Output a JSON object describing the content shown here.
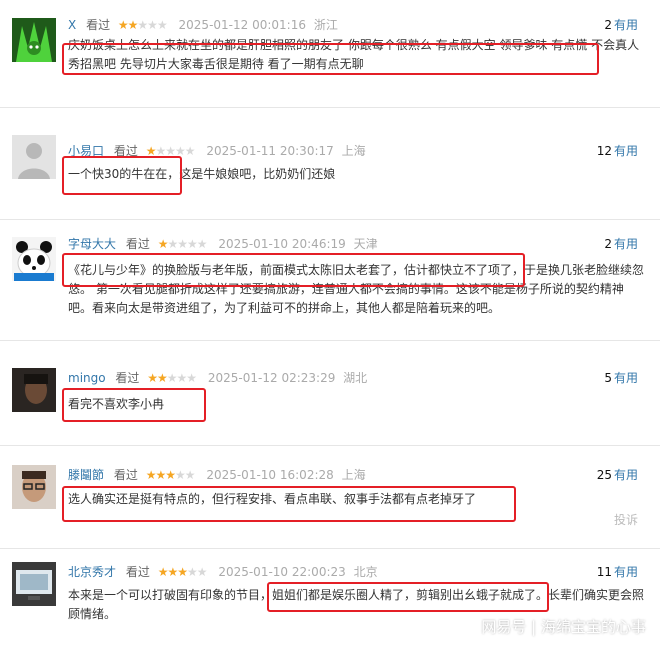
{
  "reviews": [
    {
      "user": "X",
      "action": "看过",
      "stars": 2,
      "date": "2025-01-12 00:01:16",
      "region": "浙江",
      "useful_count": "2",
      "useful_label": "有用",
      "highlight": "庆奶饭桌上怎么上来就在坐的都是肝胆相照的朋友了 你跟每个很熟么 有点假大空 领导爹味 有点慌",
      "rest": " 不会真人秀招黑吧 先导切片大家毒舌很是期待 看了一期有点无聊",
      "avatar": "green-creature-icon"
    },
    {
      "user": "小易口",
      "action": "看过",
      "stars": 1,
      "date": "2025-01-11 20:30:17",
      "region": "上海",
      "useful_count": "12",
      "useful_label": "有用",
      "highlight": "一个快30的牛在在，",
      "rest": "这是牛娘娘吧，比奶奶们还娘",
      "avatar": "default-avatar-icon"
    },
    {
      "user": "字母大大",
      "action": "看过",
      "stars": 1,
      "date": "2025-01-10 20:46:19",
      "region": "天津",
      "useful_count": "2",
      "useful_label": "有用",
      "pre": "《花儿与少年》的换脸版与老年版，前面模式太陈旧太老套了，估计都快立不了项了，",
      "rest": "于是换几张老脸继续忽悠。 第一次看见腿都折成这样了还要搞旅游，连普通人都不会搞的事情。这该不能是杨子所说的契约精神吧。看来向太是带资进组了，为了利益可不的拼命上，其他人都是陪着玩来的吧。",
      "avatar": "panda-avatar-icon"
    },
    {
      "user": "mingo",
      "action": "看过",
      "stars": 2,
      "date": "2025-01-12 02:23:29",
      "region": "湖北",
      "useful_count": "5",
      "useful_label": "有用",
      "highlight": "看完不喜欢李小冉",
      "avatar": "dark-portrait-avatar-icon"
    },
    {
      "user": "滕鬮節",
      "action": "看过",
      "stars": 3,
      "date": "2025-01-10 16:02:28",
      "region": "上海",
      "useful_count": "25",
      "useful_label": "有用",
      "highlight": "选人确实还是挺有特点的，但行程安排、看点串联、叙事手法都有点老掉牙了",
      "report": "投诉",
      "avatar": "man-glasses-avatar-icon"
    },
    {
      "user": "北京秀才",
      "action": "看过",
      "stars": 3,
      "date": "2025-01-10 22:00:23",
      "region": "北京",
      "useful_count": "11",
      "useful_label": "有用",
      "pre": "本来是一个可以打破固有印象的节目，",
      "highlight": "姐姐们都是娱乐圈人精了，剪辑别出幺蛾子就成了",
      "rest": "。长辈们确实更会照顾情绪。",
      "avatar": "screen-avatar-icon"
    }
  ],
  "watermark": "网易号 | 海绵宝宝的心事"
}
